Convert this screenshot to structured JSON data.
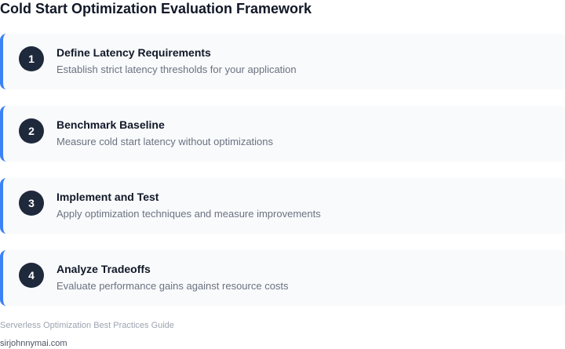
{
  "title": "Cold Start Optimization Evaluation Framework",
  "steps": [
    {
      "number": "1",
      "title": "Define Latency Requirements",
      "description": "Establish strict latency thresholds for your application"
    },
    {
      "number": "2",
      "title": "Benchmark Baseline",
      "description": "Measure cold start latency without optimizations"
    },
    {
      "number": "3",
      "title": "Implement and Test",
      "description": "Apply optimization techniques and measure improvements"
    },
    {
      "number": "4",
      "title": "Analyze Tradeoffs",
      "description": "Evaluate performance gains against resource costs"
    }
  ],
  "footer": {
    "caption": "Serverless Optimization Best Practices Guide",
    "site": "sirjohnnymai.com"
  },
  "colors": {
    "accent": "#3b82f6",
    "badge": "#1e293b",
    "card_background": "#f8fafc"
  }
}
